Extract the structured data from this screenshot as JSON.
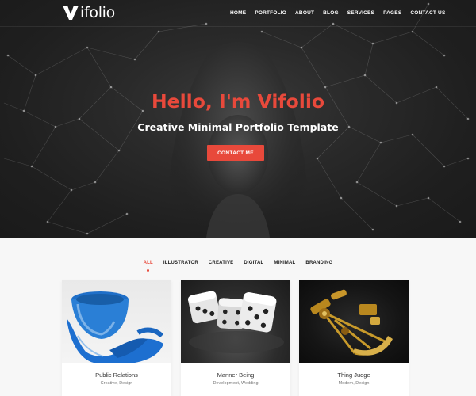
{
  "brand": {
    "logo_text": "ifolio",
    "logo_mark": "V"
  },
  "nav": {
    "items": [
      "HOME",
      "PORTFOLIO",
      "ABOUT",
      "BLOG",
      "SERVICES",
      "PAGES",
      "CONTACT US"
    ]
  },
  "hero": {
    "title": "Hello, I'm Vifolio",
    "subtitle": "Creative Minimal Portfolio Template",
    "cta_label": "CONTACT ME"
  },
  "filters": {
    "items": [
      "ALL",
      "ILLUSTRATOR",
      "CREATIVE",
      "DIGITAL",
      "MINIMAL",
      "BRANDING"
    ],
    "active": "ALL"
  },
  "portfolio": {
    "cards": [
      {
        "title": "Public Relations",
        "meta": "Creative, Design",
        "image": "blue-bowl-cloth"
      },
      {
        "title": "Manner Being",
        "meta": "Development, Wedding",
        "image": "dice"
      },
      {
        "title": "Thing Judge",
        "meta": "Modern, Design",
        "image": "sextant"
      }
    ]
  },
  "colors": {
    "accent": "#e8493b",
    "hero_bg": "#222222",
    "page_bg": "#f7f7f7"
  }
}
